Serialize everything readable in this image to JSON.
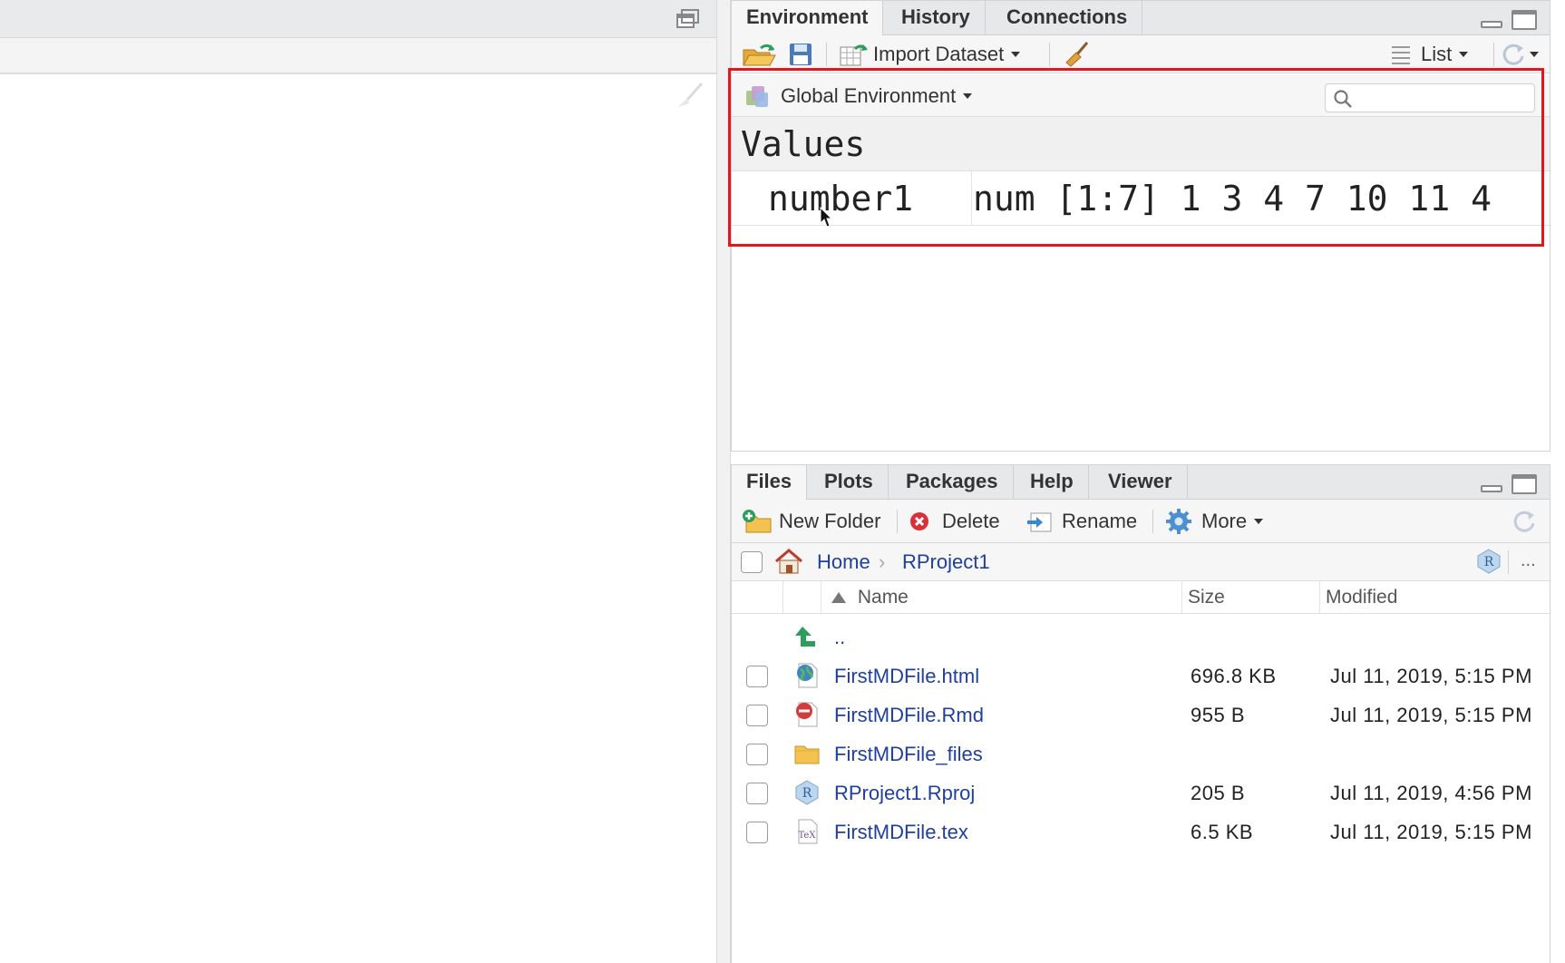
{
  "environment_pane": {
    "tabs": [
      "Environment",
      "History",
      "Connections"
    ],
    "toolbar": {
      "import_dataset": "Import Dataset",
      "view_mode": "List"
    },
    "scope": "Global Environment",
    "search": {
      "placeholder": ""
    },
    "section_heading": "Values",
    "values": [
      {
        "name": "number1",
        "description": "num [1:7] 1 3 4 7 10 11 4"
      }
    ]
  },
  "files_pane": {
    "tabs": [
      "Files",
      "Plots",
      "Packages",
      "Help",
      "Viewer"
    ],
    "toolbar": {
      "new_folder": "New Folder",
      "delete": "Delete",
      "rename": "Rename",
      "more": "More"
    },
    "breadcrumb": {
      "home": "Home",
      "separator": "›",
      "current": "RProject1"
    },
    "more_menu": "...",
    "columns": {
      "name": "Name",
      "size": "Size",
      "modified": "Modified"
    },
    "parent_dir": "..",
    "files": [
      {
        "name": "FirstMDFile.html",
        "size": "696.8 KB",
        "modified": "Jul 11, 2019, 5:15 PM",
        "icon": "html-globe-icon"
      },
      {
        "name": "FirstMDFile.Rmd",
        "size": "955 B",
        "modified": "Jul 11, 2019, 5:15 PM",
        "icon": "rmd-file-icon"
      },
      {
        "name": "FirstMDFile_files",
        "size": "",
        "modified": "",
        "icon": "folder-icon"
      },
      {
        "name": "RProject1.Rproj",
        "size": "205 B",
        "modified": "Jul 11, 2019, 4:56 PM",
        "icon": "rproj-file-icon"
      },
      {
        "name": "FirstMDFile.tex",
        "size": "6.5 KB",
        "modified": "Jul 11, 2019, 5:15 PM",
        "icon": "tex-file-icon"
      }
    ]
  },
  "colors": {
    "highlight": "#e3161c",
    "link": "#1f3fa0"
  }
}
